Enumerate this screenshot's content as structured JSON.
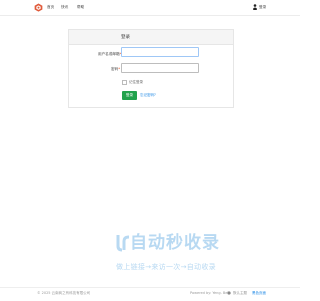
{
  "nav": {
    "items": [
      {
        "label": "首页"
      },
      {
        "label": "快讯"
      },
      {
        "label": "帮助"
      }
    ]
  },
  "user": {
    "login_label": "登录"
  },
  "login": {
    "title": "登录",
    "username_label": "用户名或邮箱",
    "password_label": "密码",
    "required_mark": "*",
    "username_value": "",
    "password_value": "",
    "remember_label": "记住登录",
    "remember_checked": false,
    "submit_label": "登录",
    "forgot_label": "忘记密码?"
  },
  "watermark": {
    "main": "自动秒收录",
    "sub": "做上链接→来访一次→自动收录"
  },
  "footer": {
    "copyright": "© 2025 云南商之有科技有限公司",
    "powered": "Powered by: Yeng. Beta",
    "theme": "默认主题",
    "link": "黑色页面"
  },
  "colors": {
    "accent_green": "#22a24c",
    "link_blue": "#1e88e5",
    "logo_red": "#e05a3a",
    "watermark_blue": "#b8d9f2"
  },
  "icons": [
    "logo-icon",
    "user-icon",
    "theme-icon",
    "watermark-logo-icon"
  ]
}
